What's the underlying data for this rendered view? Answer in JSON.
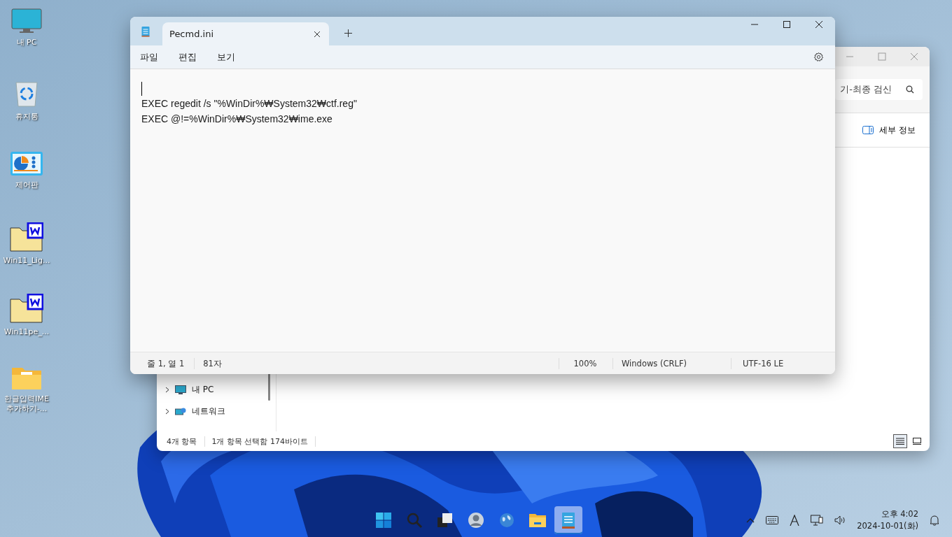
{
  "desktop_icons": [
    {
      "label": "내 PC",
      "kind": "pc"
    },
    {
      "label": "휴지통",
      "kind": "bin"
    },
    {
      "label": "제어판",
      "kind": "control"
    },
    {
      "label": "Win11_Lig...",
      "kind": "wfolder"
    },
    {
      "label": "Win11pe_...",
      "kind": "wfolder"
    },
    {
      "label": "한글입력IME 추가하기-...",
      "kind": "folder"
    }
  ],
  "explorer": {
    "search_text": "기-최종 검신",
    "details_button": "세부 정보",
    "nav_items": [
      {
        "label": "내 PC",
        "kind": "pc"
      },
      {
        "label": "네트워크",
        "kind": "network"
      }
    ],
    "status": [
      "4개 항목",
      "1개 항목 선택함 174바이트"
    ],
    "view_buttons": [
      {
        "kind": "details",
        "selected": true
      },
      {
        "kind": "tiles",
        "selected": false
      }
    ]
  },
  "notepad": {
    "tab": "Pecmd.ini",
    "menu": [
      "파일",
      "편집",
      "보기"
    ],
    "lines": [
      "EXEC regedit /s \"%WinDir%₩System32₩ctf.reg\"",
      "EXEC @!=%WinDir%₩System32₩ime.exe"
    ],
    "status": [
      "줄 1, 열 1",
      "81자",
      "100%",
      "Windows (CRLF)",
      "UTF-16 LE"
    ]
  },
  "taskbar": {
    "apps": [
      {
        "kind": "start",
        "selected": false
      },
      {
        "kind": "search",
        "selected": false
      },
      {
        "kind": "taskview",
        "selected": false
      },
      {
        "kind": "avatar",
        "selected": false
      },
      {
        "kind": "globe",
        "selected": false
      },
      {
        "kind": "explorer",
        "selected": false
      },
      {
        "kind": "notepad",
        "selected": true
      }
    ],
    "time": "오후 4:02",
    "date": "2024-10-01(화)"
  }
}
